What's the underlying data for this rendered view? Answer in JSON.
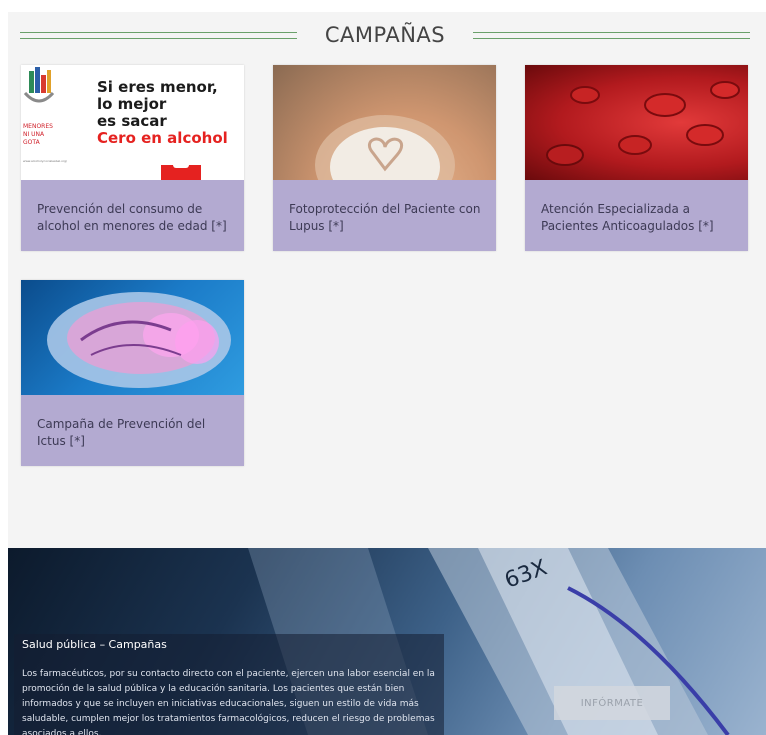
{
  "section": {
    "title": "CAMPAÑAS"
  },
  "cards": [
    {
      "caption": "Prevención del consumo de alcohol en menores de edad [*]",
      "thumb_text": {
        "line1": "Si eres menor,",
        "line2": "lo mejor",
        "line3": "es sacar",
        "line4": "Cero en alcohol",
        "badge1": "MENORES",
        "badge2": "NI UNA",
        "badge3": "GOTA",
        "url": "www.alcoholycocialesbel.org/"
      }
    },
    {
      "caption": "Fotoprotección del Paciente con Lupus [*]"
    },
    {
      "caption": "Atención Especializada a Pacientes Anticoagulados [*]"
    },
    {
      "caption": "Campaña de Prevención del Ictus [*]"
    }
  ],
  "banner": {
    "title": "Salud pública – Campañas",
    "text": "Los farmacéuticos, por su contacto directo con el paciente, ejercen una labor esencial en la promoción de la salud pública y la educación sanitaria. Los pacientes que están bien informados y que se incluyen en iniciativas educacionales, siguen un estilo de vida más saludable, cumplen mejor los tratamientos farmacológicos, reducen el riesgo de problemas asociados a ellos,",
    "button_label": "INFÓRMATE",
    "scope_text": "63X"
  }
}
